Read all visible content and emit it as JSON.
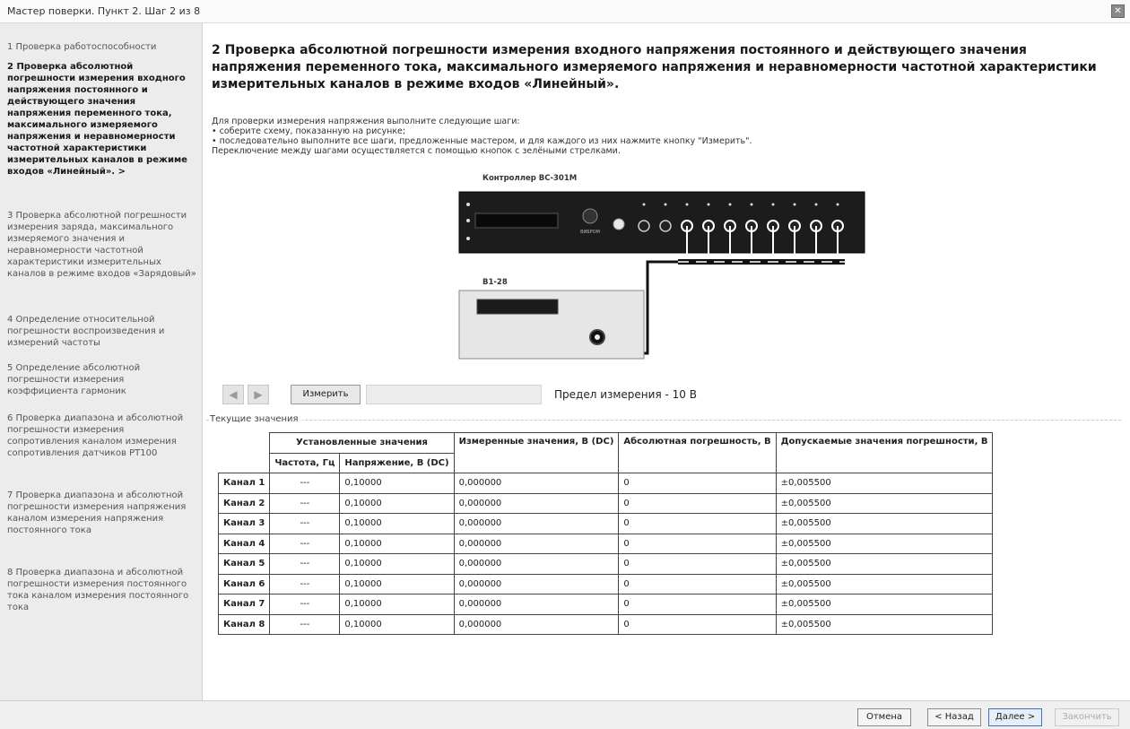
{
  "window": {
    "title": "Мастер поверки. Пункт 2. Шаг 2 из 8",
    "close_glyph": "✕"
  },
  "sidebar": {
    "steps": [
      {
        "label": "1 Проверка работоспособности",
        "active": false
      },
      {
        "label": "2 Проверка абсолютной погрешности измерения входного напряжения постоянного и действующего значения напряжения переменного тока, максимального измеряемого напряжения и неравномерности частотной характеристики измерительных каналов в режиме входов «Линейный». >",
        "active": true
      },
      {
        "label": "3 Проверка абсолютной погрешности измерения заряда, максимального измеряемого значения и неравномерности частотной характеристики измерительных каналов в режиме входов «Зарядовый»",
        "active": false
      },
      {
        "label": "4 Определение относительной погрешности воспроизведения и измерений частоты",
        "active": false
      },
      {
        "label": "5 Определение абсолютной погрешности измерения коэффициента гармоник",
        "active": false
      },
      {
        "label": "6 Проверка диапазона и абсолютной погрешности измерения сопротивления каналом измерения сопротивления датчиков PT100",
        "active": false
      },
      {
        "label": "7 Проверка диапазона и абсолютной погрешности измерения напряжения каналом измерения напряжения постоянного тока",
        "active": false
      },
      {
        "label": "8 Проверка диапазона и абсолютной погрешности измерения постоянного тока каналом измерения постоянного тока",
        "active": false
      }
    ]
  },
  "main": {
    "heading": "2 Проверка абсолютной погрешности измерения входного напряжения постоянного и действующего значения напряжения переменного тока, максимального измеряемого напряжения и неравномерности частотной характеристики измерительных каналов в режиме входов «Линейный».",
    "instructions": [
      "Для проверки измерения напряжения выполните следующие шаги:",
      "• соберите схему, показанную на рисунке;",
      "• последовательно выполните все шаги, предложенные мастером, и для каждого из них нажмите кнопку \"Измерить\".",
      "Переключение между шагами осуществляется с помощью кнопок с зелёными стрелками."
    ],
    "diagram": {
      "controller_label": "Контроллер ВС-301М",
      "generator_label": "В1-28",
      "brand_text": "ВИБРОМ"
    },
    "controls": {
      "prev_glyph": "◀",
      "next_glyph": "▶",
      "measure_label": "Измерить",
      "range_label": "Предел измерения - 10 В"
    },
    "group_label": "Текущие значения",
    "table": {
      "headers": {
        "set_values": "Установленные значения",
        "frequency": "Частота, Гц",
        "voltage": "Напряжение, В (DC)",
        "measured": "Измеренные значения, В (DC)",
        "abs_error": "Абсолютная погрешность, В",
        "allowed": "Допускаемые значения погрешности, В"
      },
      "rows": [
        {
          "channel": "Канал 1",
          "freq": "---",
          "voltage": "0,10000",
          "measured": "0,000000",
          "error": "0",
          "allowed": "±0,005500"
        },
        {
          "channel": "Канал 2",
          "freq": "---",
          "voltage": "0,10000",
          "measured": "0,000000",
          "error": "0",
          "allowed": "±0,005500"
        },
        {
          "channel": "Канал 3",
          "freq": "---",
          "voltage": "0,10000",
          "measured": "0,000000",
          "error": "0",
          "allowed": "±0,005500"
        },
        {
          "channel": "Канал 4",
          "freq": "---",
          "voltage": "0,10000",
          "measured": "0,000000",
          "error": "0",
          "allowed": "±0,005500"
        },
        {
          "channel": "Канал 5",
          "freq": "---",
          "voltage": "0,10000",
          "measured": "0,000000",
          "error": "0",
          "allowed": "±0,005500"
        },
        {
          "channel": "Канал 6",
          "freq": "---",
          "voltage": "0,10000",
          "measured": "0,000000",
          "error": "0",
          "allowed": "±0,005500"
        },
        {
          "channel": "Канал 7",
          "freq": "---",
          "voltage": "0,10000",
          "measured": "0,000000",
          "error": "0",
          "allowed": "±0,005500"
        },
        {
          "channel": "Канал 8",
          "freq": "---",
          "voltage": "0,10000",
          "measured": "0,000000",
          "error": "0",
          "allowed": "±0,005500"
        }
      ]
    }
  },
  "footer": {
    "cancel_label": "Отмена",
    "back_label": "< Назад",
    "next_label": "Далее >",
    "finish_label": "Закончить"
  }
}
